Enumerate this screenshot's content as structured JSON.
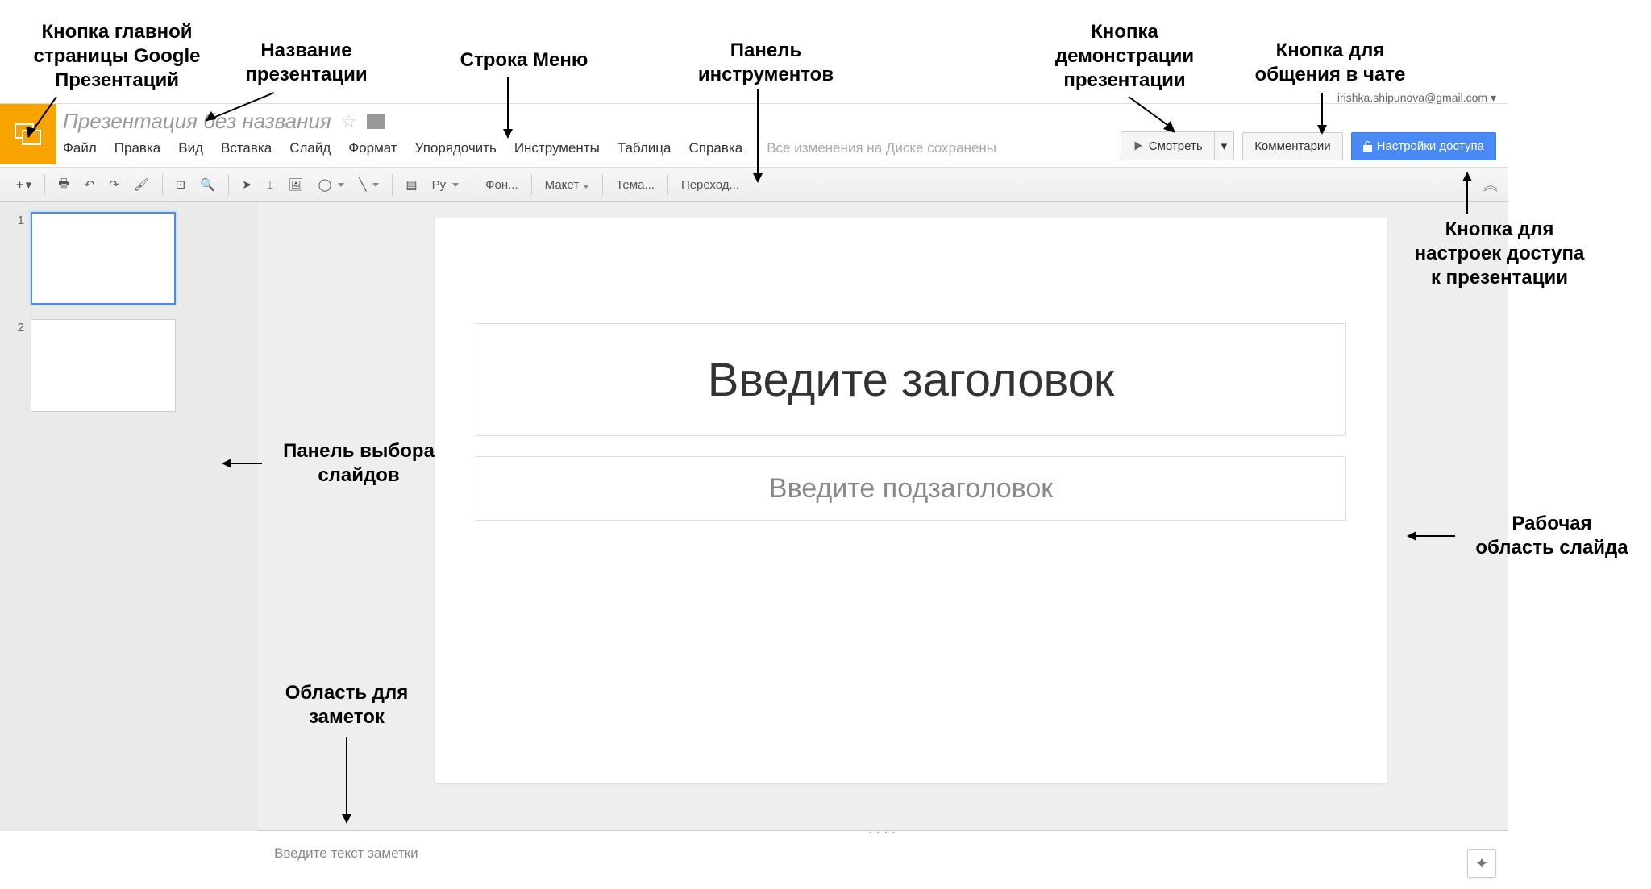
{
  "annotations": {
    "home_button": "Кнопка главной\nстраницы Google\nПрезентаций",
    "presentation_name": "Название\nпрезентации",
    "menu_row": "Строка Меню",
    "toolbar_panel": "Панель\nинструментов",
    "present_button": "Кнопка\nдемонстрации\nпрезентации",
    "chat_button": "Кнопка для\nобщения в чате",
    "share_button": "Кнопка для\nнастроек доступа\nк презентации",
    "slide_panel": "Панель выбора\nслайдов",
    "work_area": "Рабочая\nобласть слайда",
    "notes_area": "Область для\nзаметок"
  },
  "header": {
    "title": "Презентация без названия",
    "user_email": "irishka.shipunova@gmail.com",
    "present_label": "Смотреть",
    "comments_label": "Комментарии",
    "share_label": "Настройки доступа"
  },
  "menu": {
    "items": [
      "Файл",
      "Правка",
      "Вид",
      "Вставка",
      "Слайд",
      "Формат",
      "Упорядочить",
      "Инструменты",
      "Таблица",
      "Справка"
    ],
    "save_status": "Все изменения на Диске сохранены"
  },
  "toolbar": {
    "font_label": "Фон...",
    "layout_label": "Макет",
    "theme_label": "Тема...",
    "transition_label": "Переход...",
    "py_label": "Ру"
  },
  "slides": {
    "items": [
      {
        "num": "1"
      },
      {
        "num": "2"
      }
    ]
  },
  "canvas": {
    "title_placeholder": "Введите заголовок",
    "subtitle_placeholder": "Введите подзаголовок"
  },
  "notes": {
    "placeholder": "Введите текст заметки"
  }
}
